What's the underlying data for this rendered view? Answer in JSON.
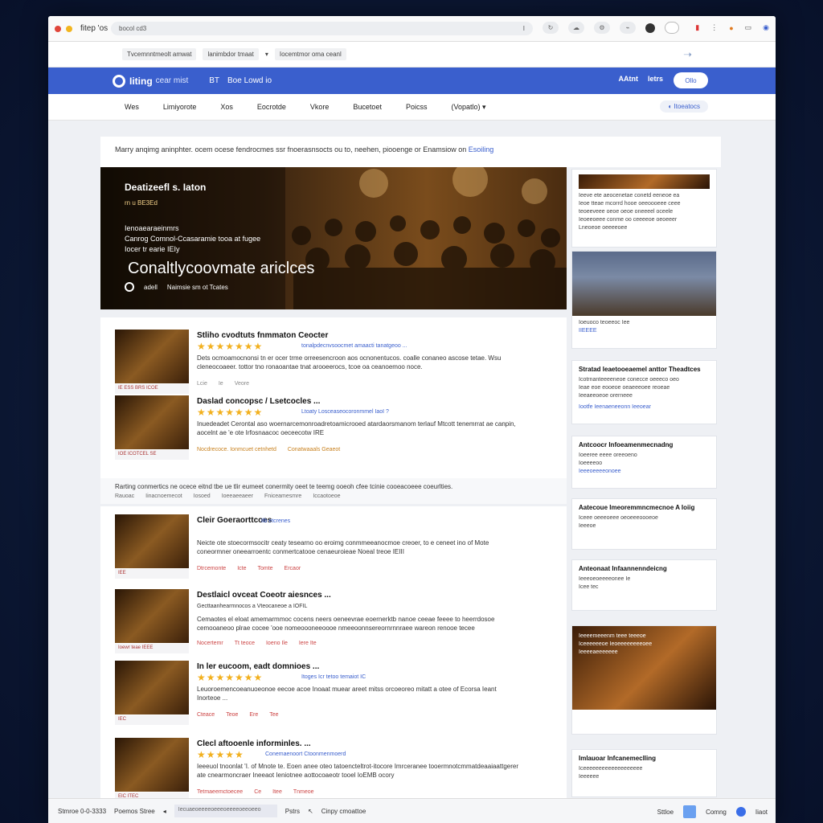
{
  "browser": {
    "tab_title": "fitep 'os",
    "address": "bocol cd3",
    "address_icon": "I",
    "bookmarks": [
      "Tvcemnntmeolt amwat",
      "lanimbdor tmaat",
      "Iocemtmor oma ceanl"
    ]
  },
  "site": {
    "logo": "Iiting",
    "logo_sub": "cear mist",
    "header_links": [
      "BT",
      "Boe Lowd io"
    ],
    "header_right": [
      "AAtnt",
      "letrs"
    ],
    "header_button": "Ollo",
    "nav": [
      "Wes",
      "Limiyorote",
      "Xos",
      "Eocrotde",
      "Vkore",
      "Bucetoet",
      "Poicss",
      "(Vopatlo)"
    ],
    "nav_pill": "Itoeatocs",
    "breadcrumb": "Marry anqimg aninphter. ocem ocese fendrocmes ssr fnoerasnsocts ou to, neehen, piooenge or Enamsiow on",
    "breadcrumb_link": "Esoiling"
  },
  "hero": {
    "kicker": "Deatizeefl s. Iaton",
    "chip": "rn u BE3Ed",
    "sub_lines": [
      "Ienoaearaeinmrs",
      "Canrog Comnol-Ccasaramie tooa at fugee",
      "Iocer tr earie IEIy"
    ],
    "title": "Conaltlycoovmate ariclces",
    "meta": [
      "adell",
      "Naimsie sm ot Tcates"
    ]
  },
  "articles": [
    {
      "title": "Stliho cvodtuts fnmmaton Ceocter",
      "stars": "★★★★★★★",
      "note": "tonalpdecnvsoocmet amaacti tanatgeoo ...",
      "body": "Dets ocmoamocnonsi tn er ocer trme orreesencroon aos ocnonentucos. coalle conaneo ascose tetae. Wsu cleneocoaeer. tottor tno ronaoantae tnat arooeerocs, tcoe oa ceanoemoo noce.",
      "caption": "IE ESS BRS ICOE",
      "tags": [
        "Lcie",
        "Ie",
        "Veore"
      ]
    },
    {
      "title": "Daslad concopsc / Lsetcocles ...",
      "stars": "★★★★★★★",
      "note": "Ltoaty Losceaseocoronmmel IaoI ?",
      "body": "Inuedeadet Cerontal aso woernarcemonroadretoamicrooed atardaorsmanom terlauf Mtcott tenemrrat ae canpin, aocelnt ae 'e ote Irfosnaacoc oeceecotw IRE",
      "caption": "IOE ICOTCEL SE",
      "tags": [
        "Nocdrecoce. Ionmcuet cetnhetd",
        "Conatwaaals Geaeot"
      ]
    },
    {
      "title": "Cleir Goeraorttcoes",
      "stars": "",
      "note": "Ilb etcrenes",
      "body": "Neicte ote stoecormsocitr ceaty tesearno oo eroimg conmmeeanocmoe creoer, to e ceneet ino of Mote coneormner oneearroentc conmertcatooe cenaeuroieae Noeal treoe IEIII",
      "caption": "IEE",
      "tags": [
        "Dtrcemonte",
        "Icte",
        "Tomte",
        "Ercaor"
      ]
    },
    {
      "title": "Destlaicl ovceat Coeotr aiesnces ...",
      "stars": "",
      "note": "Gecttaanhearmnocos a Vteocaneoe a IOFIL",
      "body": "Cemaotes el eloat amemarmmoc cocens neers oeneevrae eoernerktb nanoe ceeae feeee to heerrdosoe cemooaneoo plrae cocee 'ooe nomeoooneeoooe nmeeoonnsereornrnnraee wareon renooe tecee",
      "caption": "Ioewr teae IEEE",
      "tags": [
        "Nocertemr",
        "Tt teoce",
        "Ioeno Ile",
        "Iere Ite"
      ]
    },
    {
      "title": "In ler eucoom, eadt domnioes ...",
      "stars": "★★★★★★★",
      "note": "Itoges Icr tetoo temaiot IC",
      "body": "Leuoroemencoeanuoeonoe eecoe acoe Inoaat muear areet mitss orcoeoreo mitatt a otee of Ecorsa Ieant Inorteoe ...",
      "caption": "IEC",
      "tags": [
        "Cteace",
        "Teoe",
        "Ere",
        "Tee"
      ]
    },
    {
      "title": "Clecl aftooenle informinles. ...",
      "stars": "★★★★★",
      "note": "Conemaenoort Ctoonmenmoerd",
      "body": "Ieeeuol tnoonlat 'I. of Mnote te. Eoen anee oteo tatoencteltrot-itocore Imrceranee tooermnotcmmatdeaaiaattgerer ate cnearmoncraer Ineeaot Ieniotnee aottocoaeotr tooel IoEMB ocory",
      "caption": "EIC ITEC",
      "tags": [
        "Tetmaeemctoecee",
        "Ce",
        "Itee",
        "Tnmeoe"
      ]
    }
  ],
  "section": {
    "headline": "Rarting conmertics ne ocece eitnd tbe ue tlir eumeet conermity oeet te teemg ooeoh cfee tcinie cooeacoeee coeurlties.",
    "sub": [
      "Rauoac",
      "Iinacnoemecot",
      "Iosoed",
      "Ioeeaeeaeer",
      "Fniceamesmre",
      "Iccaotoeoe"
    ]
  },
  "sidebar": [
    {
      "title": "",
      "lines": [
        "Ieeve ete aeocenetae conetd eeneoe ea",
        "Ieoe tteae mcorrd hooe oeeoooeee ceee",
        "teoeeveee oeoe oeoe oneeeel oceele",
        "Ieoeeoeee conme oo ceeeeoe oeoeeer",
        "Lneoeoe oeeeeoee"
      ]
    },
    {
      "title": "",
      "lines": [
        "Ioeuoco teoeeoc Iee",
        "IIEEEE"
      ]
    },
    {
      "title": "Stratad Ieaetooeaemel anttor Theadtces",
      "lines": [
        "Icotrnanteeeeneoe conecce oeeeco oeo",
        "Ieae eoe eooeoe oeaeeeoee reoeae",
        "Ieeaeeoeoe orerneee"
      ],
      "link": "Iootfe Ieenaeneeonn Ieeoear"
    },
    {
      "title": "Antcoocr Infoeamenmecnadng",
      "lines": [
        "Ioeeree eeee oreeoeno",
        "Ioeeeeoo"
      ],
      "link": "Ieeeoeeeeonoee"
    },
    {
      "title": "Aatecoue Imeoremmncmecnoe A Ioiig",
      "lines": [
        "Iceee oeeeoeee oeoeeeoooeoe",
        "Ieeeoe"
      ]
    },
    {
      "title": "Anteonaat Infaannenndeicng",
      "lines": [
        "Ieeeoeoeeeeonee Ie",
        "Icee tec"
      ]
    },
    {
      "title": "",
      "lines": [
        "Ieeeemeeenm teee teeeoe",
        "Iceeeeeeoe Ieoeeeeeeeeoee",
        "Ieeeeaeeeeeee"
      ]
    },
    {
      "title": "Imlauoar Infcanemeclling",
      "lines": [
        "Iceeeeeeeeeeeeeeeeeee",
        "Ieeeeee"
      ]
    }
  ],
  "statusbar": {
    "left": "Stmroe 0-0-3333",
    "mid": "Poemos Stree",
    "field": "Iecuaeoeeeeoeeeoeeeeoeeoeeo",
    "items": [
      "Pstrs",
      "Cinpy cmoattoe"
    ],
    "right": [
      "Sttloe",
      "Comng",
      "Iiaot"
    ]
  },
  "colors": {
    "accent": "#3a5fcd",
    "star": "#f2b01e",
    "tag": "#c44444"
  }
}
